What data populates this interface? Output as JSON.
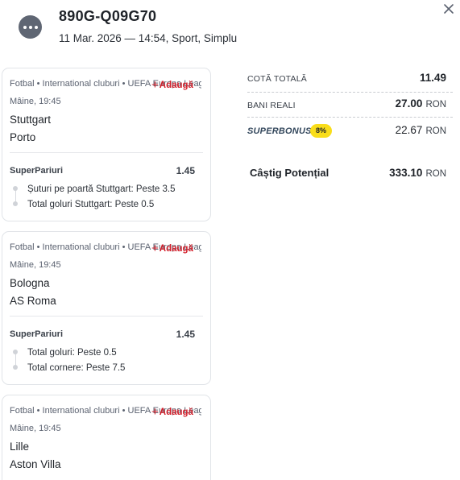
{
  "header": {
    "ticket_id": "890G-Q09G70",
    "meta": "11 Mar. 2026 — 14:54, Sport, Simplu",
    "more_icon": "more-horizontal-icon",
    "close_icon": "close-icon"
  },
  "events": [
    {
      "breadcrumb": "Fotbal • International cluburi • UEFA Europa League",
      "add_label": "Adaugă",
      "time": "Mâine, 19:45",
      "team1": "Stuttgart",
      "team2": "Porto",
      "market": "SuperPariuri",
      "odd": "1.45",
      "selections": [
        "Șuturi pe poartă Stuttgart: Peste 3.5",
        "Total goluri Stuttgart: Peste 0.5"
      ]
    },
    {
      "breadcrumb": "Fotbal • International cluburi • UEFA Europa League",
      "add_label": "Adaugă",
      "time": "Mâine, 19:45",
      "team1": "Bologna",
      "team2": "AS Roma",
      "market": "SuperPariuri",
      "odd": "1.45",
      "selections": [
        "Total goluri: Peste 0.5",
        "Total cornere: Peste 7.5"
      ]
    },
    {
      "breadcrumb": "Fotbal • International cluburi • UEFA Europa League",
      "add_label": "Adaugă",
      "time": "Mâine, 19:45",
      "team1": "Lille",
      "team2": "Aston Villa"
    }
  ],
  "summary": {
    "total_odds_label": "COTĂ TOTALĂ",
    "total_odds_value": "11.49",
    "real_money_label": "BANI REALI",
    "real_money_value": "27.00",
    "currency": "RON",
    "superbonus_label": "SUPERBONUS",
    "superbonus_pct": "8%",
    "superbonus_value": "22.67",
    "potential_win_label": "Câștig Potențial",
    "potential_win_value": "333.10"
  },
  "colors": {
    "accent_red": "#d3202c",
    "badge_yellow": "#f9dd1a",
    "icon_gray": "#5f6673"
  }
}
